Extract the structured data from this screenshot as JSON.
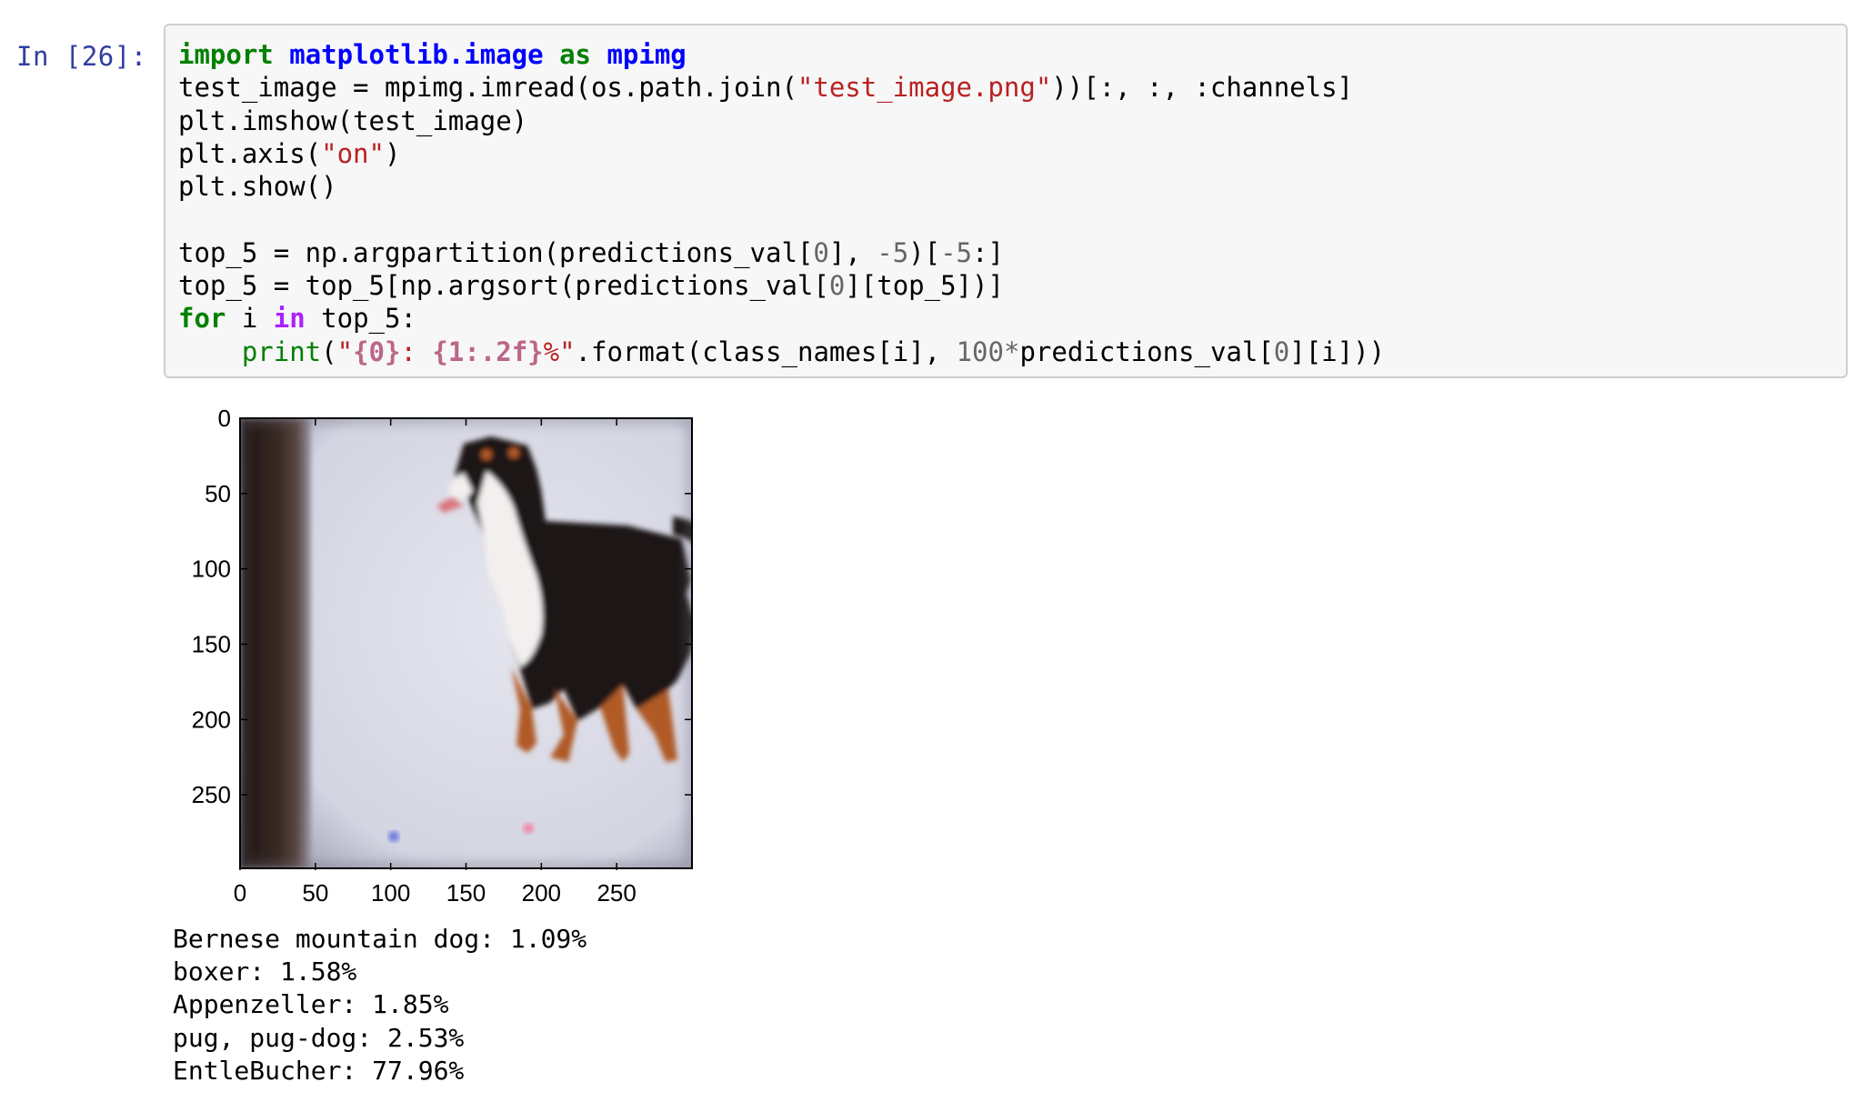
{
  "cell": {
    "prompt": "In [26]:",
    "code": {
      "line1": {
        "kw": "import",
        "mod": "matplotlib.image",
        "as": "as",
        "alias": "mpimg"
      },
      "line2": {
        "pre": "test_image = mpimg.imread(os.path.join(",
        "str": "\"test_image.png\"",
        "post": "))[:, :, :channels]"
      },
      "line3": "plt.imshow(test_image)",
      "line4": {
        "pre": "plt.axis(",
        "str": "\"on\"",
        "post": ")"
      },
      "line5": "plt.show()",
      "line7": {
        "a": "top_5 = np.argpartition(predictions_val[",
        "n0": "0",
        "b": "], ",
        "n5": "-5",
        "c": ")[",
        "n5b": "-5",
        "d": ":]"
      },
      "line8": {
        "a": "top_5 = top_5[np.argsort(predictions_val[",
        "n0": "0",
        "b": "][top_5])]"
      },
      "line9": {
        "for": "for",
        "i": " i ",
        "in": "in",
        "rest": " top_5:"
      },
      "line10": {
        "indent": "    ",
        "print": "print",
        "p1": "(",
        "s1": "\"",
        "f1": "{0}",
        "s2": ": ",
        "f2": "{1:.2f}",
        "s3": "%\"",
        "fmt": ".format(class_names[i], ",
        "hundred": "100",
        "star": "*",
        "tail": "predictions_val[",
        "n0": "0",
        "end": "][i]))"
      }
    }
  },
  "plot": {
    "y_ticks": [
      "0",
      "50",
      "100",
      "150",
      "200",
      "250"
    ],
    "x_ticks": [
      "0",
      "50",
      "100",
      "150",
      "200",
      "250"
    ],
    "axis": "on",
    "image_description_colors": {
      "background": "#d9dbe6",
      "door_frame": "#2b1e19",
      "dog_black": "#1a1416",
      "dog_white": "#f2eeee",
      "dog_tan": "#b5561f"
    }
  },
  "output": {
    "lines": [
      "Bernese mountain dog: 1.09%",
      "boxer: 1.58%",
      "Appenzeller: 1.85%",
      "pug, pug-dog: 2.53%",
      "EntleBucher: 77.96%"
    ]
  }
}
